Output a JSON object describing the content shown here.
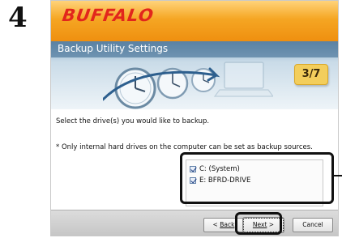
{
  "step_number": "4",
  "brand": {
    "logo_text": "BUFFALO"
  },
  "header": {
    "title": "Backup Utility Settings",
    "step_indicator": "3/7"
  },
  "content": {
    "instruction": "Select the drive(s) you would like to backup.",
    "note": "* Only internal hard drives on the computer can be set as backup sources.",
    "drives": [
      {
        "label": "C: (System)",
        "checked": true
      },
      {
        "label": "E: BFRD-DRIVE",
        "checked": true
      }
    ]
  },
  "footer": {
    "back_prefix": "< ",
    "back_label": "Back",
    "next_label": "Next",
    "next_suffix": " >",
    "cancel_label": "Cancel"
  },
  "colors": {
    "brand_orange": "#f5a623",
    "logo_red": "#e2261c",
    "header_blue": "#5b82a3",
    "step_badge": "#f3ce5c"
  }
}
